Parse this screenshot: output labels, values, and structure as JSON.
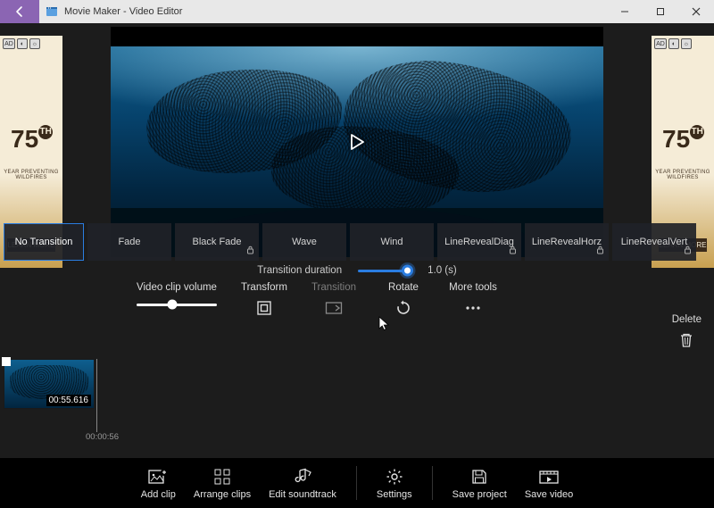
{
  "titlebar": {
    "app_title": "Movie Maker - Video Editor"
  },
  "ads": {
    "logo_num": "7",
    "logo_suffix": "5",
    "logo_ord": "TH",
    "subtitle": "YEAR PREVENTING WILDFIRES",
    "cta": "LEARN MORE",
    "badge": "AD"
  },
  "transitions": {
    "items": [
      {
        "label": "No Transition",
        "selected": true,
        "locked": false
      },
      {
        "label": "Fade",
        "selected": false,
        "locked": false
      },
      {
        "label": "Black Fade",
        "selected": false,
        "locked": true
      },
      {
        "label": "Wave",
        "selected": false,
        "locked": false
      },
      {
        "label": "Wind",
        "selected": false,
        "locked": false
      },
      {
        "label": "LineRevealDiag",
        "selected": false,
        "locked": true
      },
      {
        "label": "LineRevealHorz",
        "selected": false,
        "locked": true
      },
      {
        "label": "LineRevealVert",
        "selected": false,
        "locked": true
      }
    ]
  },
  "duration": {
    "label": "Transition duration",
    "value_text": "1.0 (s)"
  },
  "tools": {
    "volume_label": "Video clip volume",
    "transform": "Transform",
    "transition": "Transition",
    "rotate": "Rotate",
    "more": "More tools",
    "delete": "Delete"
  },
  "timeline": {
    "clip_duration": "00:55.616",
    "playhead_time": "00:00:56"
  },
  "bottombar": {
    "add_clip": "Add clip",
    "arrange_clips": "Arrange clips",
    "edit_soundtrack": "Edit soundtrack",
    "settings": "Settings",
    "save_project": "Save project",
    "save_video": "Save video"
  }
}
